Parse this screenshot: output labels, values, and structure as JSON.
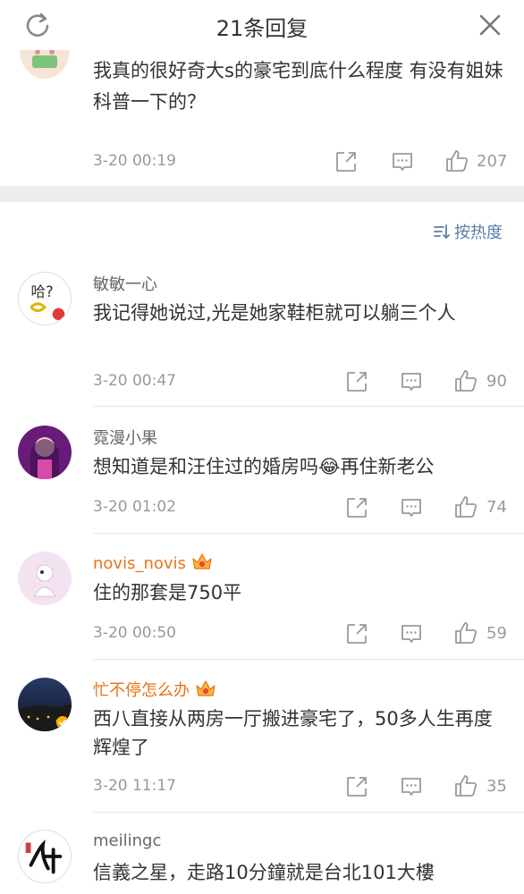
{
  "header": {
    "title": "21条回复",
    "left_icon": "refresh-icon",
    "right_icon": "close-icon"
  },
  "original_post": {
    "text": "我真的很好奇大s的豪宅到底什么程度 有没有姐妹科普一下的？",
    "time": "3-20 00:19",
    "likes": "207"
  },
  "sort_label": "按热度",
  "comments": [
    {
      "user": "敏敏一心",
      "text": "我记得她说过,光是她家鞋柜就可以躺三个人",
      "time": "3-20 00:47",
      "likes": "90",
      "vip": false
    },
    {
      "user": "霓漫小果",
      "text": "想知道是和汪住过的婚房吗😂再住新老公",
      "time": "3-20 01:02",
      "likes": "74",
      "vip": false
    },
    {
      "user": "novis_novis",
      "text": "住的那套是750平",
      "time": "3-20 00:50",
      "likes": "59",
      "vip": true
    },
    {
      "user": "忙不停怎么办",
      "text": "西八直接从两房一厅搬进豪宅了，50多人生再度辉煌了",
      "time": "3-20 11:17",
      "likes": "35",
      "vip": true
    },
    {
      "user": "meilingc",
      "text": "信義之星，走路10分鐘就是台北101大樓",
      "vip": false
    }
  ],
  "colors": {
    "vip_name": "#e57514",
    "sort_link": "#5a7fa8",
    "meta_gray": "#999999",
    "divider": "#ececec"
  }
}
